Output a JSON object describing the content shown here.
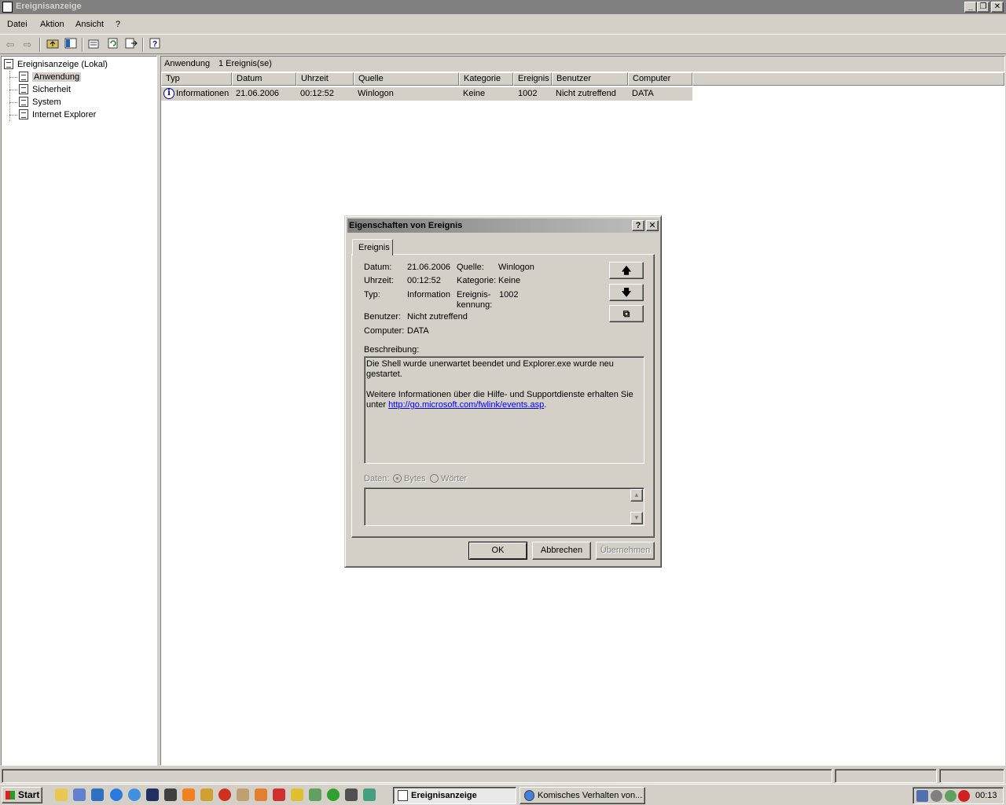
{
  "window": {
    "title": "Ereignisanzeige",
    "controls": [
      "_",
      "❐",
      "✕"
    ]
  },
  "menu": [
    "Datei",
    "Aktion",
    "Ansicht",
    "?"
  ],
  "toolbar": {
    "icons": [
      "back-arrow-icon",
      "forward-arrow-icon",
      "up-folder-icon",
      "show-tree-icon",
      "properties-icon",
      "refresh-icon",
      "export-list-icon",
      "help-icon"
    ]
  },
  "tree": {
    "root": "Ereignisanzeige (Lokal)",
    "items": [
      "Anwendung",
      "Sicherheit",
      "System",
      "Internet Explorer"
    ],
    "selected": "Anwendung"
  },
  "pane": {
    "title": "Anwendung",
    "count": "1 Ereignis(se)",
    "columns": [
      "Typ",
      "Datum",
      "Uhrzeit",
      "Quelle",
      "Kategorie",
      "Ereignis",
      "Benutzer",
      "Computer"
    ],
    "rows": [
      [
        "Informationen",
        "21.06.2006",
        "00:12:52",
        "Winlogon",
        "Keine",
        "1002",
        "Nicht zutreffend",
        "DATA"
      ]
    ]
  },
  "dialog": {
    "title": "Eigenschaften von Ereignis",
    "help_btn": "?",
    "close_btn": "✕",
    "tab": "Ereignis",
    "fields": {
      "datum_label": "Datum:",
      "datum_value": "21.06.2006",
      "uhrzeit_label": "Uhrzeit:",
      "uhrzeit_value": "00:12:52",
      "typ_label": "Typ:",
      "typ_value": "Information",
      "benutzer_label": "Benutzer:",
      "benutzer_value": "Nicht zutreffend",
      "computer_label": "Computer:",
      "computer_value": "DATA",
      "quelle_label": "Quelle:",
      "quelle_value": "Winlogon",
      "kategorie_label": "Kategorie:",
      "kategorie_value": "Keine",
      "ereignis_label_1": "Ereignis-",
      "ereignis_label_2": "kennung:",
      "ereignis_value": "1002"
    },
    "nav_buttons": {
      "up": "🡅",
      "down": "🡇",
      "copy": "⧉"
    },
    "beschreibung_label": "Beschreibung:",
    "description_line1": "Die Shell wurde unerwartet beendet und Explorer.exe wurde neu gestartet.",
    "description_line2": "Weitere Informationen über die Hilfe- und Supportdienste erhalten Sie",
    "description_line3_prefix": "unter ",
    "description_link": "http://go.microsoft.com/fwlink/events.asp",
    "description_line3_suffix": ".",
    "daten_label": "Daten:",
    "radio_bytes": "Bytes",
    "radio_woerter": "Wörter",
    "radio_selected": "Bytes",
    "buttons": {
      "ok": "OK",
      "cancel": "Abbrechen",
      "apply": "Übernehmen"
    }
  },
  "taskbar": {
    "start": "Start",
    "tasks": [
      "Ereignisanzeige",
      "Komisches Verhalten von..."
    ],
    "active_task": "Ereignisanzeige",
    "clock": "00:13"
  }
}
